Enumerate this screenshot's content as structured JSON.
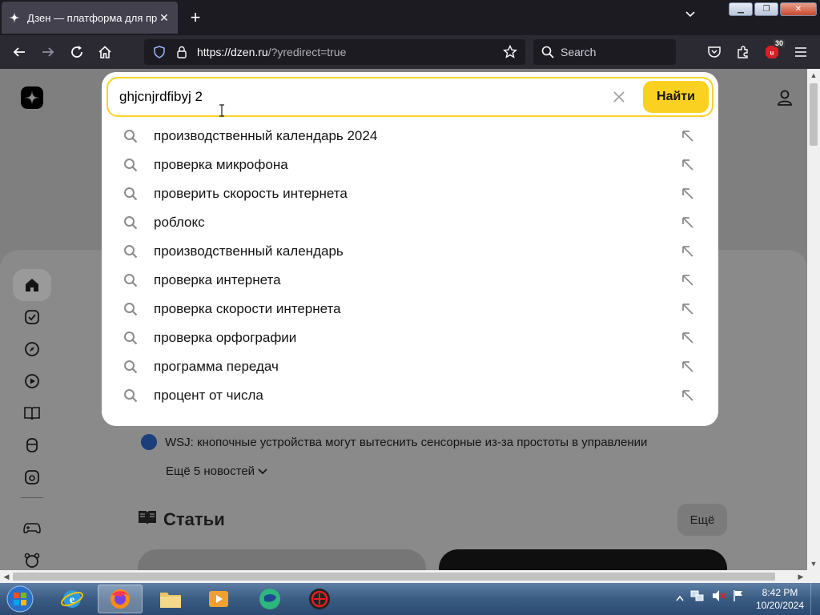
{
  "browser": {
    "tab_title": "Дзен — платформа для просмотра",
    "url_host": "https://dzen.ru",
    "url_path": "/?yredirect=true",
    "search_placeholder": "Search",
    "extension_badge": "30"
  },
  "header": {
    "logo": "dzen-logo"
  },
  "search": {
    "query": "ghjcnjrdfibyj 2",
    "submit_label": "Найти",
    "suggestions": [
      "производственный календарь 2024",
      "проверка микрофона",
      "проверить скорость интернета",
      "роблокс",
      "производственный календарь",
      "проверка интернета",
      "проверка скорости интернета",
      "проверка орфографии",
      "программа передач",
      "процент от числа"
    ]
  },
  "news": {
    "item_text": "WSJ: кнопочные устройства могут вытеснить сенсорные из-за простоты в управлении",
    "more_label": "Ещё 5 новостей"
  },
  "articles": {
    "title": "Статьи",
    "more_label": "Ещё"
  },
  "sidebar": {
    "icons": [
      "home-icon",
      "subscriptions-icon",
      "explore-icon",
      "video-icon",
      "articles-icon",
      "podcasts-icon",
      "shows-icon",
      "games-icon",
      "kids-icon"
    ]
  },
  "taskbar": {
    "time": "8:42 PM",
    "date": "10/20/2024"
  },
  "colors": {
    "accent_yellow": "#fbd121",
    "browser_dark": "#2b2a33",
    "overlay_gray": "#808080"
  }
}
